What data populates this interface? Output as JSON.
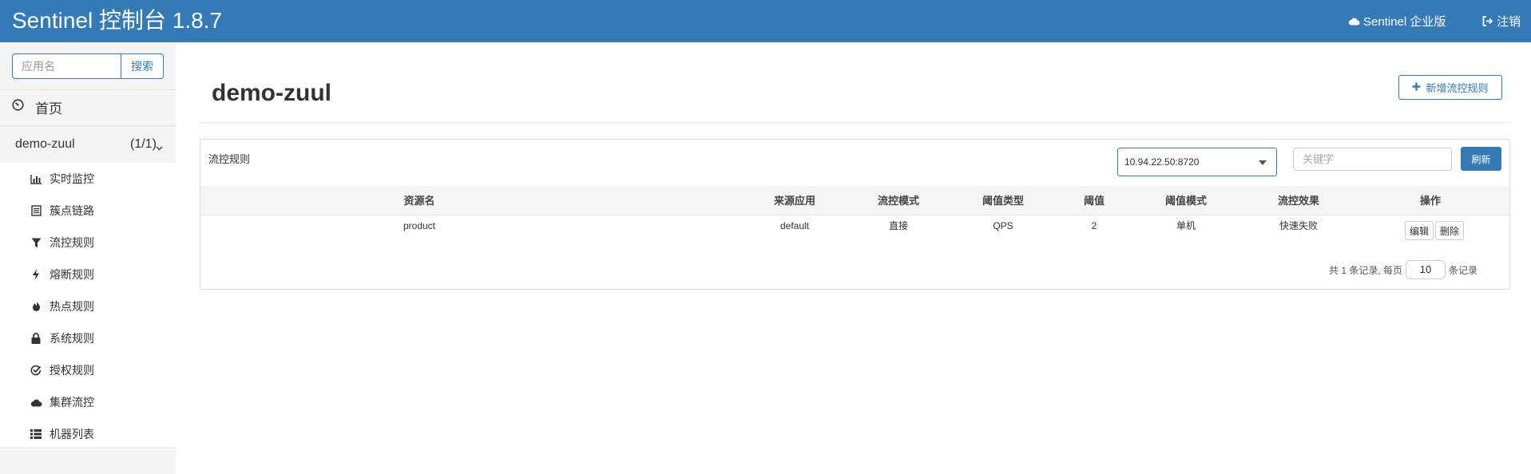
{
  "header": {
    "title": "Sentinel 控制台 1.8.7",
    "enterprise_label": "Sentinel 企业版",
    "logout_label": "注销"
  },
  "sidebar": {
    "search_placeholder": "应用名",
    "search_button": "搜索",
    "home_label": "首页",
    "app": {
      "name": "demo-zuul",
      "count": "(1/1)"
    },
    "items": [
      {
        "label": "实时监控",
        "icon": "bar-chart-icon"
      },
      {
        "label": "簇点链路",
        "icon": "list-alt-icon"
      },
      {
        "label": "流控规则",
        "icon": "filter-icon"
      },
      {
        "label": "熔断规则",
        "icon": "flash-icon"
      },
      {
        "label": "热点规则",
        "icon": "fire-icon"
      },
      {
        "label": "系统规则",
        "icon": "lock-icon"
      },
      {
        "label": "授权规则",
        "icon": "check-icon"
      },
      {
        "label": "集群流控",
        "icon": "cloud-icon"
      },
      {
        "label": "机器列表",
        "icon": "th-list-icon"
      }
    ]
  },
  "main": {
    "page_title": "demo-zuul",
    "add_button": "新增流控规则",
    "panel": {
      "title": "流控规则",
      "machine_selected": "10.94.22.50:8720",
      "keyword_placeholder": "关键字",
      "refresh_button": "刷新",
      "columns": [
        "资源名",
        "来源应用",
        "流控模式",
        "阈值类型",
        "阈值",
        "阈值模式",
        "流控效果",
        "操作"
      ],
      "rows": [
        {
          "resource": "product",
          "limit_app": "default",
          "strategy": "直接",
          "grade": "QPS",
          "count": "2",
          "cluster_mode": "单机",
          "control_behavior": "快速失败",
          "edit_button": "编辑",
          "delete_button": "删除"
        }
      ],
      "pager": {
        "prefix": "共 1 条记录, 每页",
        "page_size": "10",
        "suffix": "条记录"
      }
    }
  },
  "colors": {
    "primary": "#337ab7",
    "sidebar_bg": "#f4f4f4"
  }
}
